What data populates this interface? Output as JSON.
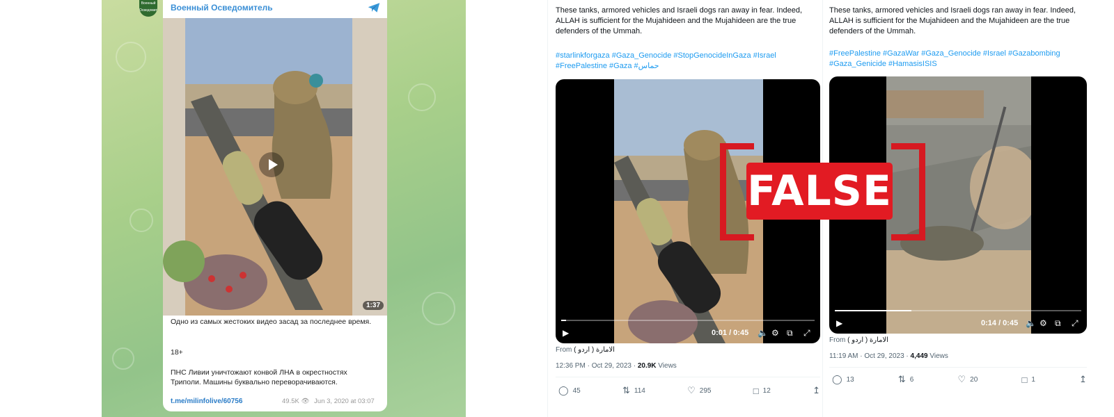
{
  "telegram": {
    "channel_name": "Военный Осведомитель",
    "avatar_text": "Военный Осведомитель",
    "video_duration": "1:37",
    "post_line1": "Одно из самых жестоких видео засад за последнее время.",
    "post_line2": "18+",
    "post_line3": "ПНС Ливии уничтожают конвой ЛНА в окрестностях Триполи. Машины буквально переворачиваются.",
    "link": "t.me/milinfolive/60756",
    "views": "49.5K",
    "date": "Jun 3, 2020 at 03:07"
  },
  "tweet_left": {
    "text": "These tanks, armored vehicles and Israeli dogs ran away in fear. Indeed, ALLAH is sufficient for the Mujahideen and the Mujahideen are the true defenders of the Ummah.",
    "hashtags": "#starlinkforgaza #Gaza_Genocide #StopGenocideInGaza #Israel #FreePalestine #Gaza #حماس",
    "video_time": "0:01 / 0:45",
    "video_progress": 0.02,
    "from_label": "From",
    "from_source": "الامارة ( اردو )",
    "time": "12:36 PM · Oct 29, 2023 · ",
    "views_count": "20.9K",
    "views_label": " Views",
    "replies": "45",
    "retweets": "114",
    "likes": "295",
    "bookmarks": "12"
  },
  "tweet_right": {
    "text": "These tanks, armored vehicles and Israeli dogs ran away in fear. Indeed, ALLAH is sufficient for the Mujahideen and the Mujahideen are the true defenders of the Ummah.",
    "hashtags": "#FreePalestine #GazaWar #Gaza_Genocide #Israel #Gazabombing #Gaza_Genicide #HamasisISIS",
    "video_time": "0:14 / 0:45",
    "video_progress": 0.31,
    "from_label": "From",
    "from_source": "الامارة ( اردو )",
    "time": "11:19 AM · Oct 29, 2023 · ",
    "views_count": "4,449",
    "views_label": " Views",
    "replies": "13",
    "retweets": "6",
    "likes": "20",
    "bookmarks": "1"
  },
  "stamp": {
    "label": "FALSE",
    "color": "#e21b23"
  },
  "icons": {
    "telegram": "paper-plane-icon",
    "play": "play-icon",
    "volume": "volume-icon",
    "settings": "gear-icon",
    "fullscreen": "expand-icon",
    "reply": "reply-icon",
    "retweet": "retweet-icon",
    "like": "heart-icon",
    "bookmark": "bookmark-icon",
    "share": "share-icon"
  }
}
